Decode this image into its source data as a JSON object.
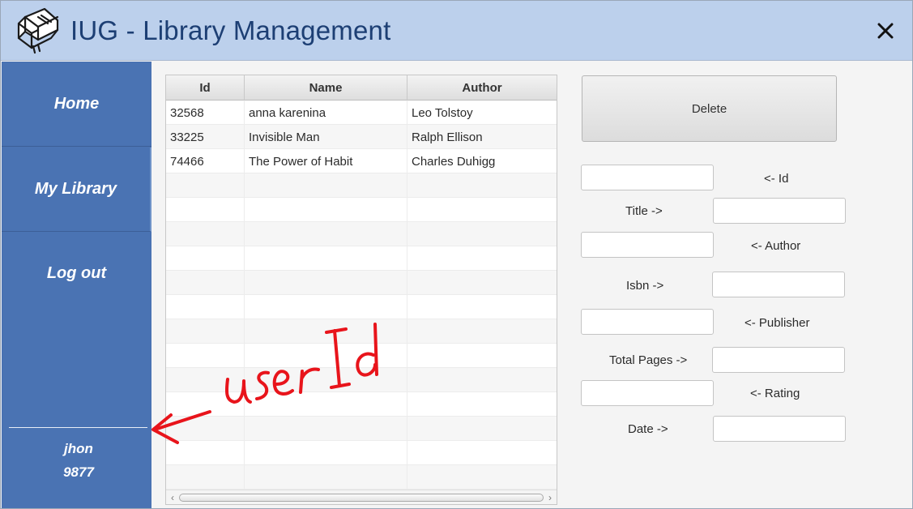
{
  "window": {
    "title": "IUG - Library Management",
    "close_symbol": "✕"
  },
  "sidebar": {
    "items": [
      {
        "label": "Home"
      },
      {
        "label": "My Library"
      },
      {
        "label": "Log out"
      }
    ],
    "user": {
      "name": "jhon",
      "id": "9877"
    }
  },
  "table": {
    "columns": [
      "Id",
      "Name",
      "Author"
    ],
    "rows": [
      [
        "32568",
        "anna karenina",
        "Leo Tolstoy"
      ],
      [
        "33225",
        "Invisible Man",
        "Ralph Ellison"
      ],
      [
        "74466",
        "The Power of Habit",
        "Charles Duhigg"
      ],
      [
        "",
        "",
        ""
      ],
      [
        "",
        "",
        ""
      ],
      [
        "",
        "",
        ""
      ],
      [
        "",
        "",
        ""
      ],
      [
        "",
        "",
        ""
      ],
      [
        "",
        "",
        ""
      ],
      [
        "",
        "",
        ""
      ],
      [
        "",
        "",
        ""
      ],
      [
        "",
        "",
        ""
      ],
      [
        "",
        "",
        ""
      ],
      [
        "",
        "",
        ""
      ],
      [
        "",
        "",
        ""
      ],
      [
        "",
        "",
        ""
      ]
    ]
  },
  "form": {
    "delete_label": "Delete",
    "id_label": "<- Id",
    "title_label": "Title ->",
    "author_label": "<- Author",
    "isbn_label": "Isbn ->",
    "publisher_label": "<- Publisher",
    "total_pages_label": "Total Pages ->",
    "rating_label": "<- Rating",
    "date_label": "Date ->",
    "id_value": "",
    "title_value": "",
    "author_value": "",
    "isbn_value": "",
    "publisher_value": "",
    "total_pages_value": "",
    "rating_value": "",
    "date_value": ""
  },
  "annotation": {
    "text": "user Id",
    "color": "#e8141b"
  },
  "colors": {
    "titlebar": "#bcd0ec",
    "title_text": "#1d3f74",
    "sidebar": "#4a73b3"
  }
}
